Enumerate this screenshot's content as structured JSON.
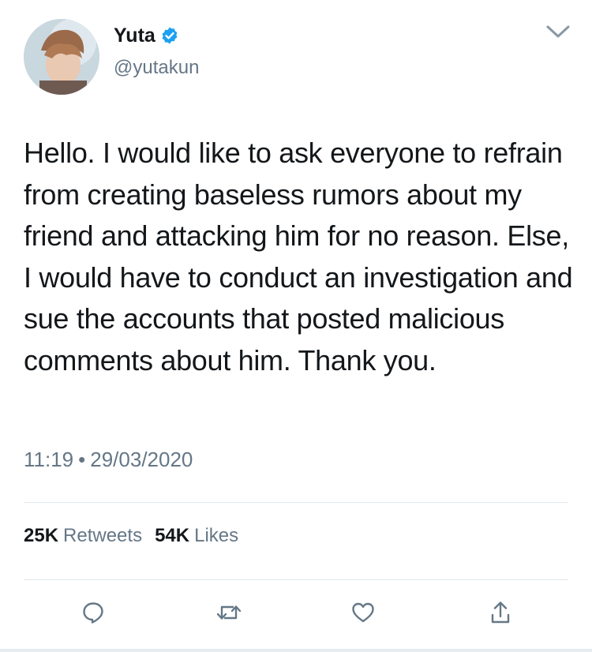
{
  "author": {
    "display_name": "Yuta",
    "handle": "@yutakun",
    "avatar_icon": "avatar-photo",
    "verified_icon": "verified-badge-icon"
  },
  "tweet": {
    "text": "Hello. I would like to ask everyone to refrain from creating baseless rumors about my friend and attacking him for no reason. Else, I would have to conduct an investigation and sue the accounts that posted malicious comments about him. Thank you.",
    "time": "11:19",
    "separator": "•",
    "date": "29/03/2020"
  },
  "stats": {
    "retweets_count": "25K",
    "retweets_label": "Retweets",
    "likes_count": "54K",
    "likes_label": "Likes"
  },
  "actions": {
    "reply_icon": "reply-icon",
    "retweet_icon": "retweet-icon",
    "like_icon": "heart-icon",
    "share_icon": "share-icon"
  },
  "colors": {
    "text_primary": "#14171a",
    "text_secondary": "#657786",
    "verified_blue": "#1da1f2",
    "divider": "#e1e8ed"
  }
}
